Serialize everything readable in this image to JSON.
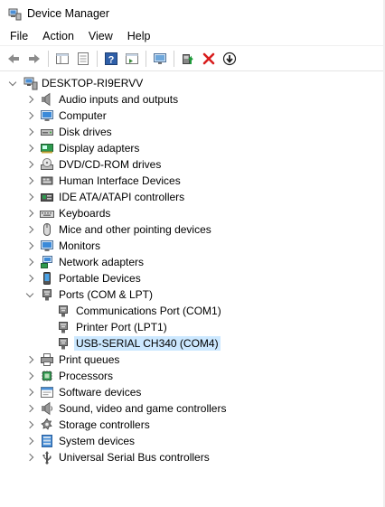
{
  "window": {
    "title": "Device Manager",
    "icon": "device-manager-icon"
  },
  "menu": [
    {
      "label": "File"
    },
    {
      "label": "Action"
    },
    {
      "label": "View"
    },
    {
      "label": "Help"
    }
  ],
  "toolbar": [
    {
      "name": "back-button",
      "icon": "arrow-left-icon"
    },
    {
      "name": "forward-button",
      "icon": "arrow-right-icon"
    },
    {
      "sep": true
    },
    {
      "name": "show-hide-console-tree-button",
      "icon": "console-tree-icon"
    },
    {
      "name": "properties-button",
      "icon": "properties-icon"
    },
    {
      "sep": true
    },
    {
      "name": "help-button",
      "icon": "help-icon"
    },
    {
      "name": "action-pane-button",
      "icon": "action-pane-icon"
    },
    {
      "sep": true
    },
    {
      "name": "scan-hardware-button",
      "icon": "monitor-scan-icon"
    },
    {
      "sep": true
    },
    {
      "name": "update-driver-button",
      "icon": "update-driver-icon"
    },
    {
      "name": "uninstall-device-button",
      "icon": "red-x-icon"
    },
    {
      "name": "disable-device-button",
      "icon": "down-arrow-circle-icon"
    }
  ],
  "tree": {
    "root": {
      "label": "DESKTOP-RI9ERVV",
      "icon": "computer-root-icon",
      "expanded": true
    },
    "categories": [
      {
        "label": "Audio inputs and outputs",
        "icon": "speaker-icon"
      },
      {
        "label": "Computer",
        "icon": "computer-icon"
      },
      {
        "label": "Disk drives",
        "icon": "disk-drive-icon"
      },
      {
        "label": "Display adapters",
        "icon": "display-adapter-icon"
      },
      {
        "label": "DVD/CD-ROM drives",
        "icon": "dvd-drive-icon"
      },
      {
        "label": "Human Interface Devices",
        "icon": "hid-icon"
      },
      {
        "label": "IDE ATA/ATAPI controllers",
        "icon": "ide-controller-icon"
      },
      {
        "label": "Keyboards",
        "icon": "keyboard-icon"
      },
      {
        "label": "Mice and other pointing devices",
        "icon": "mouse-icon"
      },
      {
        "label": "Monitors",
        "icon": "monitor-icon"
      },
      {
        "label": "Network adapters",
        "icon": "network-adapter-icon"
      },
      {
        "label": "Portable Devices",
        "icon": "portable-device-icon"
      },
      {
        "label": "Ports (COM & LPT)",
        "icon": "port-icon",
        "expanded": true,
        "children": [
          {
            "label": "Communications Port (COM1)",
            "icon": "port-icon"
          },
          {
            "label": "Printer Port (LPT1)",
            "icon": "port-icon"
          },
          {
            "label": "USB-SERIAL CH340 (COM4)",
            "icon": "port-icon",
            "selected": true
          }
        ]
      },
      {
        "label": "Print queues",
        "icon": "printer-icon"
      },
      {
        "label": "Processors",
        "icon": "processor-icon"
      },
      {
        "label": "Software devices",
        "icon": "software-device-icon"
      },
      {
        "label": "Sound, video and game controllers",
        "icon": "sound-controller-icon"
      },
      {
        "label": "Storage controllers",
        "icon": "storage-controller-icon"
      },
      {
        "label": "System devices",
        "icon": "system-device-icon"
      },
      {
        "label": "Universal Serial Bus controllers",
        "icon": "usb-icon"
      }
    ]
  }
}
